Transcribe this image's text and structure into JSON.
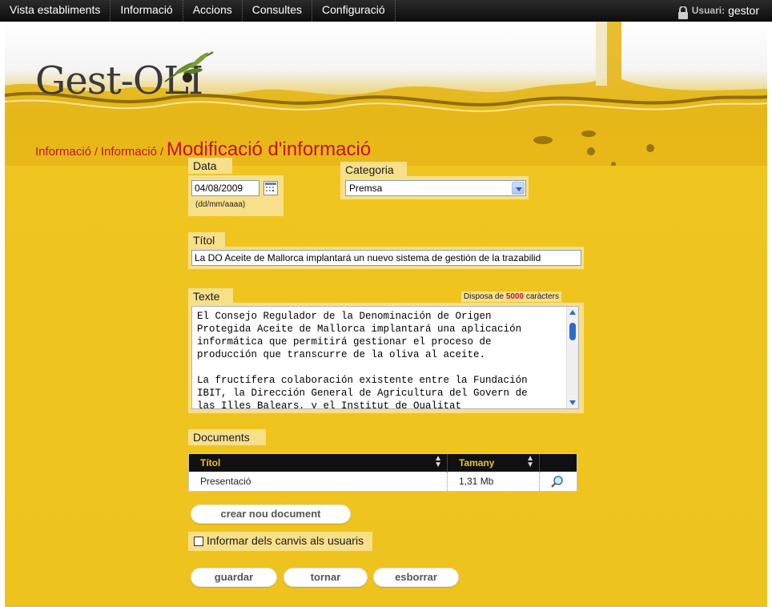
{
  "menu": {
    "items": [
      "Vista establiments",
      "Informació",
      "Accions",
      "Consultes",
      "Configuració"
    ],
    "user_label": "Usuari:",
    "user_name": "gestor"
  },
  "logo": "Gest-OLI",
  "breadcrumb": {
    "crumb1": "Informació",
    "crumb2": "Informació",
    "sep": "/",
    "current": "Modificació d'informació"
  },
  "form": {
    "date": {
      "label": "Data",
      "value": "04/08/2009",
      "hint": "(dd/mm/aaaa)"
    },
    "category": {
      "label": "Categoria",
      "value": "Premsa"
    },
    "title": {
      "label": "Títol",
      "value": "La DO Aceite de Mallorca implantará un nuevo sistema de gestión de la trazabilid"
    },
    "text": {
      "label": "Texte",
      "counter_prefix": "Disposa de",
      "counter_value": "5000",
      "counter_suffix": "caràcters",
      "lines": [
        "El Consejo Regulador de la Denominación de Origen",
        "Protegida Aceite de Mallorca implantará una aplicación",
        "informática que permitirá gestionar el proceso de",
        "producción que transcurre de la oliva al aceite.",
        "",
        "La fructífera colaboración existente entre la Fundación",
        "IBIT, la Dirección General de Agricultura del Govern de",
        "las Illes Balears, y el Institut de Qualitat"
      ]
    }
  },
  "documents": {
    "label": "Documents",
    "columns": [
      "Títol",
      "Tamany"
    ],
    "rows": [
      {
        "title": "Presentació",
        "size": "1,31 Mb"
      }
    ],
    "new_button": "crear nou document"
  },
  "notify": {
    "label": "Informar dels canvis als usuaris",
    "checked": false
  },
  "actions": {
    "save": "guardar",
    "back": "tornar",
    "delete": "esborrar"
  },
  "colors": {
    "accent_red": "#c8102e",
    "oil_yellow": "#efc31d",
    "header_gold": "#f1c21c"
  }
}
